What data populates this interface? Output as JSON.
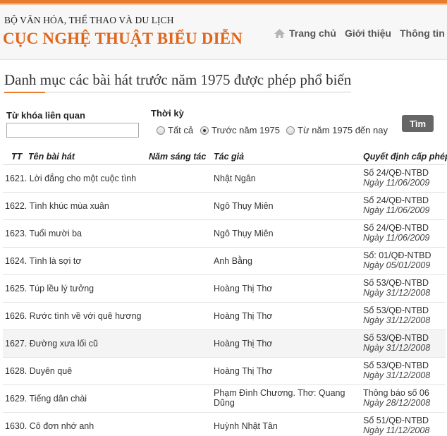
{
  "header": {
    "ministry": "BỘ VĂN HÓA, THỂ THAO VÀ DU LỊCH",
    "agency": "CỤC NGHỆ THUẬT BIỂU DIỄN"
  },
  "nav": {
    "home": "Trang chủ",
    "intro": "Giới thiệu",
    "info": "Thông tin"
  },
  "page": {
    "title": "Danh mục các bài hát trước năm 1975 được phép phổ biến"
  },
  "search": {
    "keyword_label": "Từ khóa liên quan",
    "keyword_value": "",
    "period_label": "Thời kỳ",
    "options": [
      "Tất cả",
      "Trước năm 1975",
      "Từ năm 1975 đến nay"
    ],
    "selected": "Trước năm 1975",
    "button": "Tìm"
  },
  "table": {
    "headers": {
      "tt": "TT",
      "name": "Tên bài hát",
      "year": "Năm sáng tác",
      "author": "Tác giả",
      "decision": "Quyết định cấp phép"
    },
    "rows": [
      {
        "name": "1621. Lời đắng cho một cuộc tình",
        "author": "Nhật Ngân",
        "decision": "Số 24/QĐ-NTBD",
        "date": "Ngày 11/06/2009"
      },
      {
        "name": "1622. Tình khúc mùa xuân",
        "author": "Ngô Thụy Miên",
        "decision": "Số 24/QĐ-NTBD",
        "date": "Ngày 11/06/2009"
      },
      {
        "name": "1623. Tuổi mười ba",
        "author": "Ngô Thụy Miên",
        "decision": "Số 24/QĐ-NTBD",
        "date": "Ngày 11/06/2009"
      },
      {
        "name": "1624. Tình là sợi tơ",
        "author": "Anh Bằng",
        "decision": "Số: 01/QĐ-NTBD",
        "date": "Ngày 05/01/2009"
      },
      {
        "name": "1625. Túp lều lý tưởng",
        "author": "Hoàng Thị Thơ",
        "decision": "Số 53/QĐ-NTBD",
        "date": "Ngày 31/12/2008"
      },
      {
        "name": "1626. Rước tình về với quê hương",
        "author": "Hoàng Thị Thơ",
        "decision": "Số 53/QĐ-NTBD",
        "date": "Ngày 31/12/2008"
      },
      {
        "name": "1627. Đường xưa lối cũ",
        "author": "Hoàng Thị Thơ",
        "decision": "Số 53/QĐ-NTBD",
        "date": "Ngày 31/12/2008"
      },
      {
        "name": "1628. Duyên quê",
        "author": "Hoàng Thị Thơ",
        "decision": "Số 53/QĐ-NTBD",
        "date": "Ngày 31/12/2008"
      },
      {
        "name": "1629. Tiếng dân chài",
        "author": "Phạm Đình Chương. Thơ: Quang Dũng",
        "decision": "Thông báo số 06",
        "date": "Ngày 28/12/2008"
      },
      {
        "name": "1630. Cô đơn nhớ anh",
        "author": "Huỳnh Nhật Tân",
        "decision": "Số 51/QĐ-NTBD",
        "date": "Ngày 11/12/2008"
      }
    ]
  },
  "colors": {
    "accent": "#e87b2c",
    "agency_text": "#e0661c",
    "button_bg": "#666666",
    "highlight_row": "#f4f4f4"
  }
}
